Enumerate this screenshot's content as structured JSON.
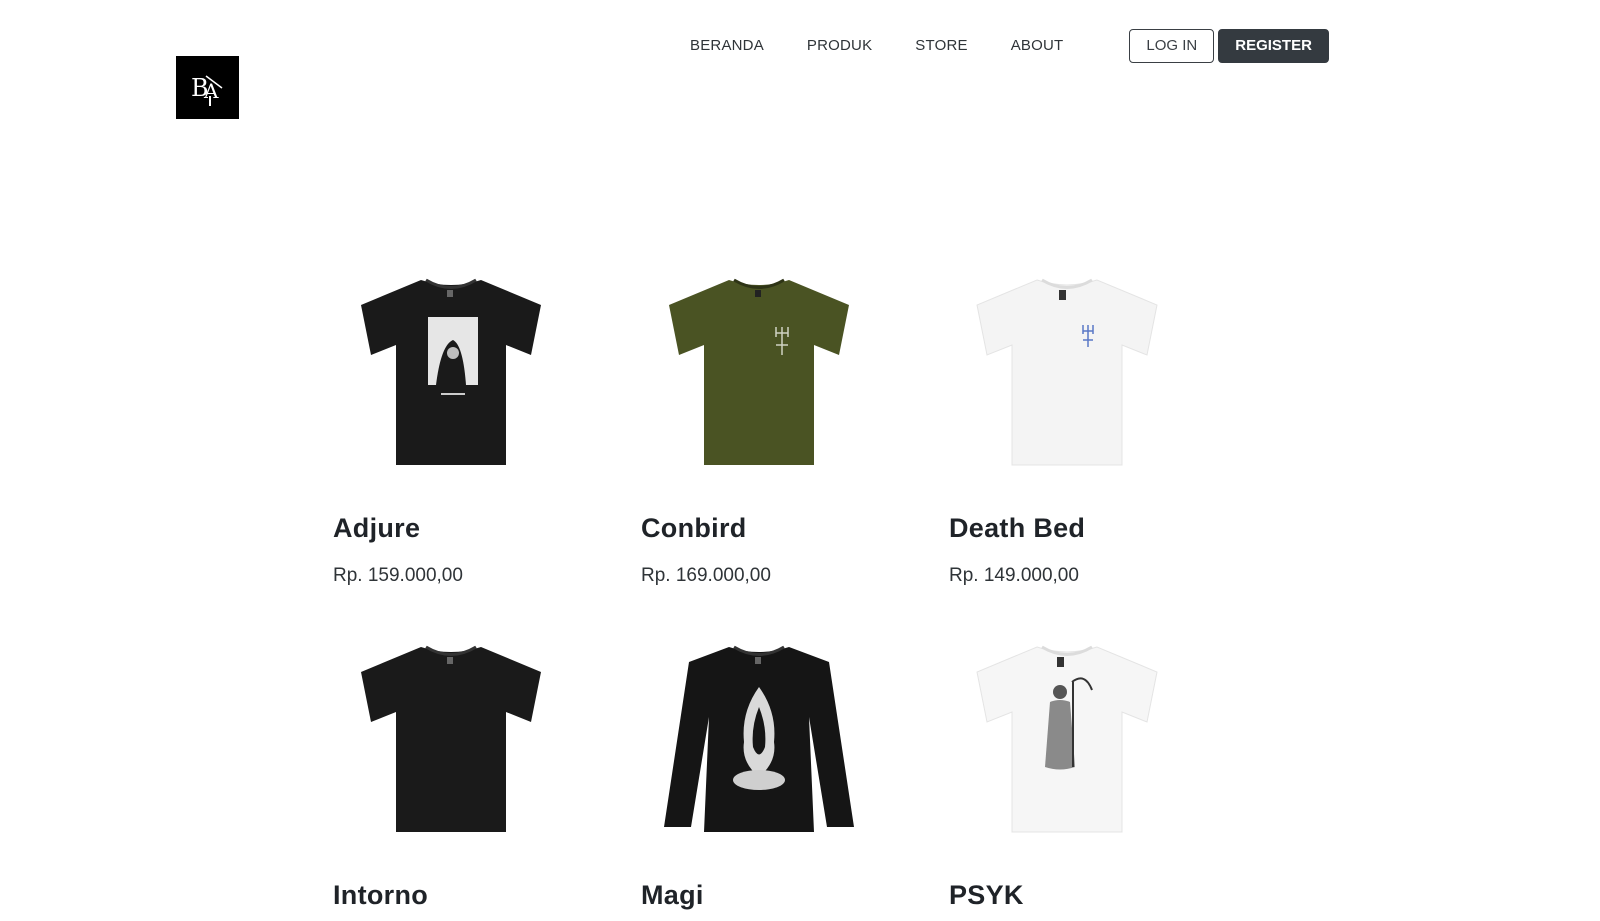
{
  "brand": {
    "logo_alt": "BA logo"
  },
  "nav": {
    "links": [
      "BERANDA",
      "PRODUK",
      "STORE",
      "ABOUT"
    ],
    "login_label": "LOG IN",
    "register_label": "REGISTER"
  },
  "products": [
    {
      "name": "Adjure",
      "price": "Rp. 159.000,00",
      "shirt_color": "#1a1a1a",
      "style": "graphic-box"
    },
    {
      "name": "Conbird",
      "price": "Rp. 169.000,00",
      "shirt_color": "#4a5323",
      "style": "small-chest-logo"
    },
    {
      "name": "Death Bed",
      "price": "Rp. 149.000,00",
      "shirt_color": "#f4f4f4",
      "style": "small-chest-logo-blue"
    },
    {
      "name": "Intorno",
      "price": "",
      "shirt_color": "#1a1a1a",
      "style": "plain"
    },
    {
      "name": "Magi",
      "price": "",
      "shirt_color": "#151515",
      "style": "longsleeve-flame"
    },
    {
      "name": "PSYK",
      "price": "",
      "shirt_color": "#f6f6f6",
      "style": "reaper"
    }
  ]
}
